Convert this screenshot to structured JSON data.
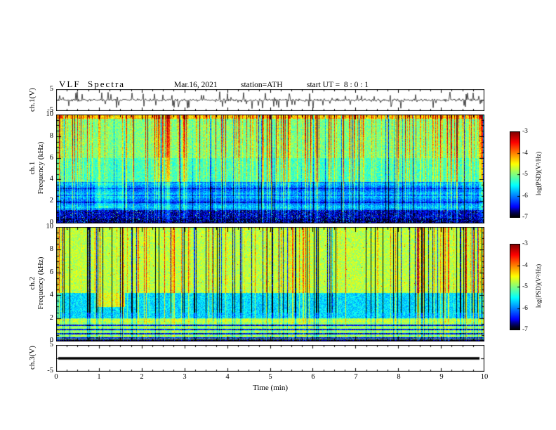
{
  "header": {
    "title": "VLF  Spectra",
    "date": "Mar.16, 2021",
    "station": "station=ATH",
    "start_ut": "start UT =  8 : 0 : 1"
  },
  "xaxis": {
    "label": "Time (min)",
    "range": [
      0,
      10
    ],
    "ticks": [
      0,
      1,
      2,
      3,
      4,
      5,
      6,
      7,
      8,
      9,
      10
    ]
  },
  "panels": {
    "waveform_ch1": {
      "ylabel": "ch.1(V)",
      "ylim": [
        -5,
        5
      ],
      "yticks": [
        5,
        -5
      ]
    },
    "spec_ch1": {
      "ylabel_line1": "ch.1",
      "ylabel_line2": "Frequency (kHz)",
      "ylim": [
        0,
        10
      ],
      "yticks": [
        10,
        8,
        6,
        4,
        2,
        0
      ]
    },
    "spec_ch2": {
      "ylabel_line1": "ch.2",
      "ylabel_line2": "Frequency (kHz)",
      "ylim": [
        0,
        10
      ],
      "yticks": [
        10,
        8,
        6,
        4,
        2,
        0
      ]
    },
    "waveform_ch3": {
      "ylabel": "ch.3(V)",
      "ylim": [
        -5,
        5
      ],
      "yticks": [
        5,
        -5
      ]
    }
  },
  "colorbar": {
    "label": "log(PSD)(V²/Hz)",
    "range": [
      -7,
      -3
    ],
    "ticks": [
      -3,
      -4,
      -5,
      -6,
      -7
    ]
  },
  "chart_data": [
    {
      "type": "line",
      "panel": "ch.1 waveform",
      "xlabel": "Time (min)",
      "xlim": [
        0,
        10
      ],
      "ylabel": "ch.1(V)",
      "ylim": [
        -5,
        5
      ],
      "yticks": [
        5,
        -5
      ],
      "description": "Dense broadband noise waveform centered on 0 V, typical excursions about ±1 V with frequent impulsive spikes reaching ±4 to ±5 V throughout the full 10 minutes"
    },
    {
      "type": "heatmap",
      "panel": "ch.1 spectrogram",
      "xlabel": "Time (min)",
      "xlim": [
        0,
        10
      ],
      "ylabel": "ch.1 Frequency (kHz)",
      "ylim": [
        0,
        10
      ],
      "yticks": [
        10,
        8,
        6,
        4,
        2,
        0
      ],
      "colorbar": {
        "label": "log(PSD)(V²/Hz)",
        "range": [
          -7,
          -3
        ],
        "ticks": [
          -3,
          -4,
          -5,
          -6,
          -7
        ],
        "colormap": "jet with black minimum"
      },
      "bands": [
        {
          "freq_khz": [
            9.7,
            10
          ],
          "mean_log_psd": -3.6
        },
        {
          "freq_khz": [
            6,
            9.7
          ],
          "mean_log_psd": -4.5
        },
        {
          "freq_khz": [
            3.8,
            6
          ],
          "mean_log_psd": -4.8
        },
        {
          "freq_khz": [
            1.2,
            3.8
          ],
          "mean_log_psd": -5.9
        },
        {
          "freq_khz": [
            0.45,
            1.2
          ],
          "mean_log_psd": -6.6
        },
        {
          "freq_khz": [
            0,
            0.45
          ],
          "mean_log_psd": -7
        }
      ],
      "features": "Dense vertical broadband sferic streaks every few seconds reaching about -3 near 8-10 kHz; darker blue band 1.2-3.8 kHz with horizontal striations; near-black band below about 1 kHz; slightly enhanced cyan-green patch near t = 1-1.6 min at 1.5-4 kHz"
    },
    {
      "type": "heatmap",
      "panel": "ch.2 spectrogram",
      "xlabel": "Time (min)",
      "xlim": [
        0,
        10
      ],
      "ylabel": "ch.2 Frequency (kHz)",
      "ylim": [
        0,
        10
      ],
      "yticks": [
        10,
        8,
        6,
        4,
        2,
        0
      ],
      "colorbar": {
        "label": "log(PSD)(V²/Hz)",
        "range": [
          -7,
          -3
        ],
        "ticks": [
          -3,
          -4,
          -5,
          -6,
          -7
        ],
        "colormap": "jet with black minimum"
      },
      "bands": [
        {
          "freq_khz": [
            4.2,
            10
          ],
          "mean_log_psd": -4.6
        },
        {
          "freq_khz": [
            2,
            4.2
          ],
          "mean_log_psd": -5.6
        },
        {
          "freq_khz": [
            0.15,
            2
          ],
          "mean_log_psd": "alternating horizontal stripes near -4.7 and -6.5"
        },
        {
          "freq_khz": [
            0,
            0.15
          ],
          "mean_log_psd": -7
        }
      ],
      "features": "Green-yellow background 4-10 kHz cut by frequent narrow near-black vertical dropouts; cyan-blue band 2-4 kHz; bright yellow patch near t = 1-1.6 min at 3-4.6 kHz; strong horizontal banding below 2 kHz"
    },
    {
      "type": "line",
      "panel": "ch.3 waveform",
      "xlabel": "Time (min)",
      "xlim": [
        0,
        10
      ],
      "ylabel": "ch.3(V)",
      "ylim": [
        -5,
        5
      ],
      "yticks": [
        5,
        -5
      ],
      "values_summary": "constant 0 V flat thick line for the full 10 minutes"
    }
  ]
}
